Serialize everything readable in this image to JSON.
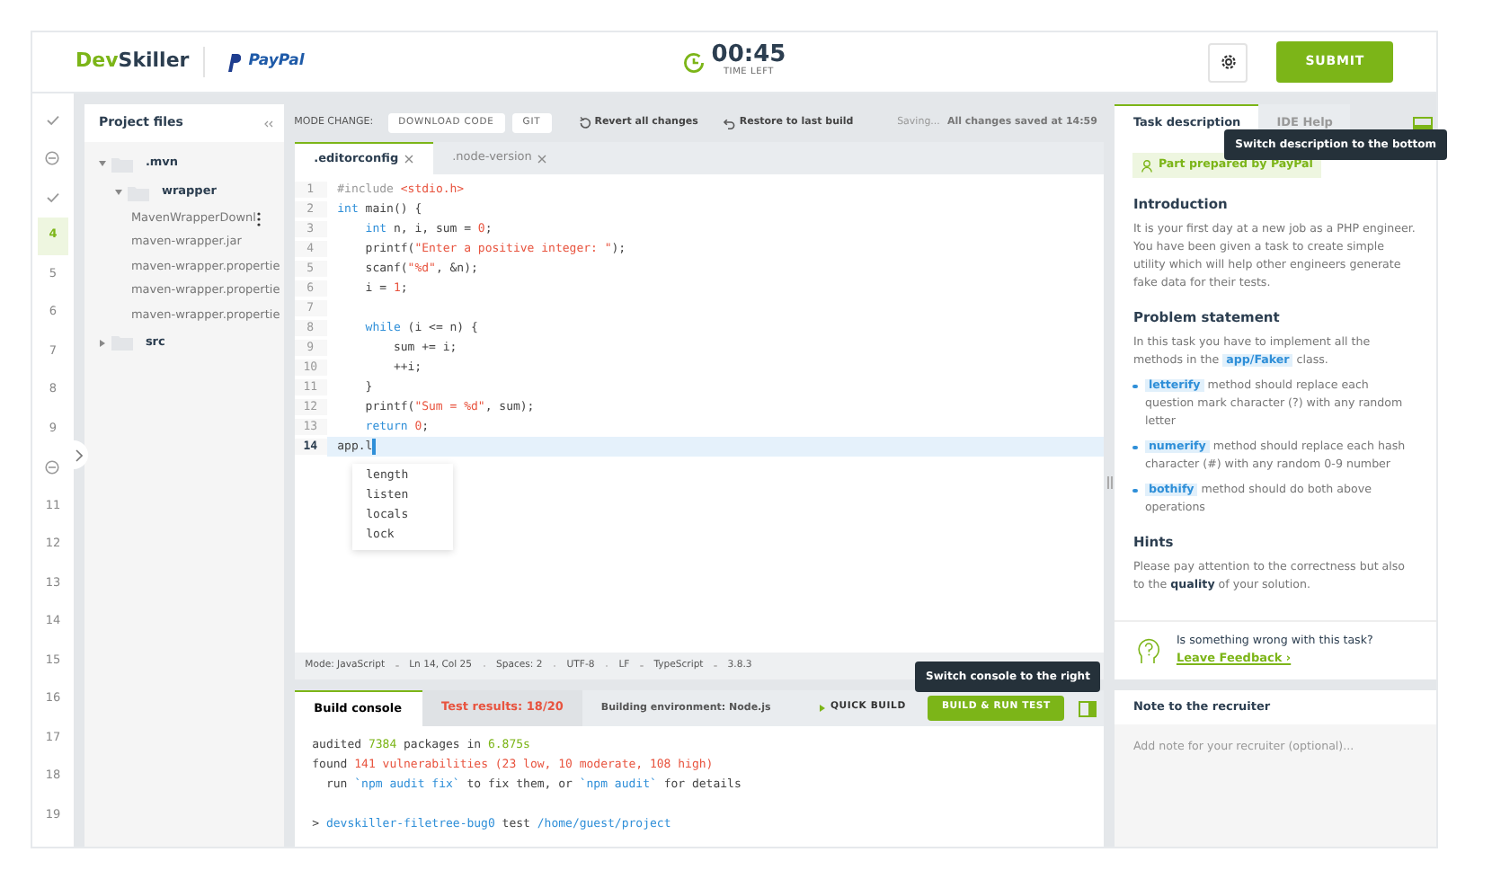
{
  "header": {
    "logo": {
      "parts": [
        "Dev",
        "Skiller"
      ]
    },
    "partner": "PayPal",
    "timer": {
      "value": "00:45",
      "caption": "TIME LEFT"
    },
    "submit": "SUBMIT"
  },
  "steps": [
    {
      "kind": "done",
      "selected": false
    },
    {
      "kind": "skipped",
      "selected": false
    },
    {
      "kind": "done",
      "selected": false
    },
    {
      "kind": "number",
      "label": "4",
      "selected": true
    },
    {
      "kind": "number",
      "label": "5",
      "selected": false
    },
    {
      "kind": "number",
      "label": "6",
      "selected": false
    },
    {
      "kind": "number",
      "label": "7",
      "selected": false
    },
    {
      "kind": "number",
      "label": "8",
      "selected": false
    },
    {
      "kind": "number",
      "label": "9",
      "selected": false
    },
    {
      "kind": "skipped",
      "selected": false
    },
    {
      "kind": "number",
      "label": "11",
      "selected": false
    },
    {
      "kind": "number",
      "label": "12",
      "selected": false
    },
    {
      "kind": "number",
      "label": "13",
      "selected": false
    },
    {
      "kind": "number",
      "label": "14",
      "selected": false
    },
    {
      "kind": "number",
      "label": "15",
      "selected": false
    },
    {
      "kind": "number",
      "label": "16",
      "selected": false
    },
    {
      "kind": "number",
      "label": "17",
      "selected": false
    },
    {
      "kind": "number",
      "label": "18",
      "selected": false
    },
    {
      "kind": "number",
      "label": "19",
      "selected": false
    }
  ],
  "files": {
    "title": "Project files",
    "tree": [
      {
        "name": ".mvn",
        "kind": "folder",
        "expanded": true,
        "children": [
          {
            "name": "wrapper",
            "kind": "folder",
            "expanded": true,
            "children": [
              {
                "name": "MavenWrapperDownl",
                "kind": "file",
                "hovered": true
              },
              {
                "name": "maven-wrapper.jar",
                "kind": "file",
                "hovered": false
              },
              {
                "name": "maven-wrapper.propertie",
                "kind": "file",
                "hovered": false
              },
              {
                "name": "maven-wrapper.propertie",
                "kind": "file",
                "hovered": false
              },
              {
                "name": "maven-wrapper.propertie",
                "kind": "file",
                "hovered": false
              }
            ]
          }
        ]
      },
      {
        "name": "src",
        "kind": "folder",
        "expanded": false
      }
    ]
  },
  "toolbar": {
    "mode_label": "MODE CHANGE:",
    "mode_buttons": [
      "DOWNLOAD CODE",
      "GIT"
    ],
    "revert": "Revert all changes",
    "restore": "Restore to last build",
    "saving": "Saving...",
    "saved": "All changes saved at 14:59"
  },
  "editor_tabs": [
    {
      "label": ".editorconfig",
      "selected": true
    },
    {
      "label": ".node-version",
      "selected": false
    }
  ],
  "code": [
    {
      "number": "1",
      "active": false,
      "tokens": [
        {
          "kind": "preproc",
          "text": "#include "
        },
        {
          "kind": "string",
          "text": "<stdio.h>"
        }
      ]
    },
    {
      "number": "2",
      "active": false,
      "tokens": [
        {
          "kind": "keyword",
          "text": "int"
        },
        {
          "kind": "plain",
          "text": " main() {"
        }
      ]
    },
    {
      "number": "3",
      "active": false,
      "tokens": [
        {
          "kind": "keyword",
          "text": "    int"
        },
        {
          "kind": "plain",
          "text": " n, i, sum = "
        },
        {
          "kind": "number",
          "text": "0"
        },
        {
          "kind": "plain",
          "text": ";"
        }
      ]
    },
    {
      "number": "4",
      "active": false,
      "tokens": [
        {
          "kind": "plain",
          "text": "    printf("
        },
        {
          "kind": "string",
          "text": "\"Enter a positive integer: \""
        },
        {
          "kind": "plain",
          "text": ");"
        }
      ]
    },
    {
      "number": "5",
      "active": false,
      "tokens": [
        {
          "kind": "plain",
          "text": "    scanf("
        },
        {
          "kind": "string",
          "text": "\"%d\""
        },
        {
          "kind": "plain",
          "text": ", &n);"
        }
      ]
    },
    {
      "number": "6",
      "active": false,
      "tokens": [
        {
          "kind": "plain",
          "text": "    i = "
        },
        {
          "kind": "number",
          "text": "1"
        },
        {
          "kind": "plain",
          "text": ";"
        }
      ]
    },
    {
      "number": "7",
      "active": false
    },
    {
      "number": "8",
      "active": false,
      "tokens": [
        {
          "kind": "keyword",
          "text": "    while"
        },
        {
          "kind": "plain",
          "text": " (i <= n) {"
        }
      ]
    },
    {
      "number": "9",
      "active": false,
      "tokens": [
        {
          "kind": "plain",
          "text": "        sum += i;"
        }
      ]
    },
    {
      "number": "10",
      "active": false,
      "tokens": [
        {
          "kind": "plain",
          "text": "        ++i;"
        }
      ]
    },
    {
      "number": "11",
      "active": false,
      "tokens": [
        {
          "kind": "plain",
          "text": "    }"
        }
      ]
    },
    {
      "number": "12",
      "active": false,
      "tokens": [
        {
          "kind": "plain",
          "text": "    printf("
        },
        {
          "kind": "string",
          "text": "\"Sum = %d\""
        },
        {
          "kind": "plain",
          "text": ", sum);"
        }
      ]
    },
    {
      "number": "13",
      "active": false,
      "tokens": [
        {
          "kind": "keyword",
          "text": "    return"
        },
        {
          "kind": "number",
          "text": " 0"
        },
        {
          "kind": "plain",
          "text": ";"
        }
      ]
    },
    {
      "number": "14",
      "active": true,
      "tokens": [
        {
          "kind": "plain",
          "text": "app.l"
        }
      ]
    }
  ],
  "autocomplete": [
    "length",
    "listen",
    "locals",
    "lock"
  ],
  "status_bar": [
    "Mode: JavaScript",
    "Ln 14, Col 25",
    "Spaces: 2",
    "UTF-8",
    "LF",
    "TypeScript",
    "3.8.3"
  ],
  "console": {
    "tabs": [
      {
        "label": "Build console",
        "kind": "normal",
        "selected": true
      },
      {
        "label": "Test results: 18/20",
        "kind": "error",
        "selected": false
      }
    ],
    "environment": "Building environment: Node.js",
    "quick_build": "QUICK BUILD",
    "build_run": "BUILD & RUN TEST",
    "tooltip": "Switch console to the right",
    "blocks": [
      [
        [
          {
            "kind": "plain",
            "text": "audited "
          },
          {
            "kind": "success",
            "text": "7384"
          },
          {
            "kind": "plain",
            "text": " packages in "
          },
          {
            "kind": "success",
            "text": "6.875s"
          }
        ],
        [
          {
            "kind": "plain",
            "text": "found "
          },
          {
            "kind": "error",
            "text": "141 vulnerabilities (23 low, 10 moderate, 108 high)"
          }
        ],
        [
          {
            "kind": "plain",
            "text": "  run "
          },
          {
            "kind": "info",
            "text": "`npm audit fix`"
          },
          {
            "kind": "plain",
            "text": " to fix them, or "
          },
          {
            "kind": "info",
            "text": "`npm audit`"
          },
          {
            "kind": "plain",
            "text": " for details"
          }
        ]
      ],
      [
        [
          {
            "kind": "plain",
            "text": "> "
          },
          {
            "kind": "info",
            "text": "devskiller-filetree-bug0"
          },
          {
            "kind": "plain",
            "text": " test "
          },
          {
            "kind": "info",
            "text": "/home/guest/project"
          }
        ]
      ]
    ]
  },
  "task": {
    "tabs": [
      {
        "label": "Task description",
        "selected": true
      },
      {
        "label": "IDE Help",
        "selected": false
      }
    ],
    "tooltip": "Switch description to the bottom",
    "badge": "Part prepared by PayPal",
    "sections": [
      {
        "heading": "Introduction",
        "paragraph": [
          {
            "kind": "plain",
            "text": "It is your first day at a new job as a PHP engineer. You have been given a task to create simple utility which will help other engineers generate fake data for their tests."
          }
        ]
      },
      {
        "heading": "Problem statement",
        "paragraph": [
          {
            "kind": "plain",
            "text": "In this task you have to implement all the methods in the "
          },
          {
            "kind": "code",
            "text": "app/Faker"
          },
          {
            "kind": "plain",
            "text": " class."
          }
        ],
        "bullets": [
          [
            {
              "kind": "code",
              "text": "letterify"
            },
            {
              "kind": "plain",
              "text": " method should replace each question mark character (?) with any random letter"
            }
          ],
          [
            {
              "kind": "code",
              "text": "numerify"
            },
            {
              "kind": "plain",
              "text": " method should replace each hash character (#) with any random 0-9 number"
            }
          ],
          [
            {
              "kind": "code",
              "text": "bothify"
            },
            {
              "kind": "plain",
              "text": " method should do both above operations"
            }
          ]
        ]
      },
      {
        "heading": "Hints",
        "paragraph": [
          {
            "kind": "rich",
            "text": "Please pay attention to the correctness but also to the **quality** of your solution."
          }
        ]
      }
    ],
    "feedback": {
      "question": "Is something wrong with this task?",
      "link": "Leave Feedback ›"
    }
  },
  "note": {
    "title": "Note to the recruiter",
    "placeholder": "Add note for your recruiter (optional)..."
  }
}
